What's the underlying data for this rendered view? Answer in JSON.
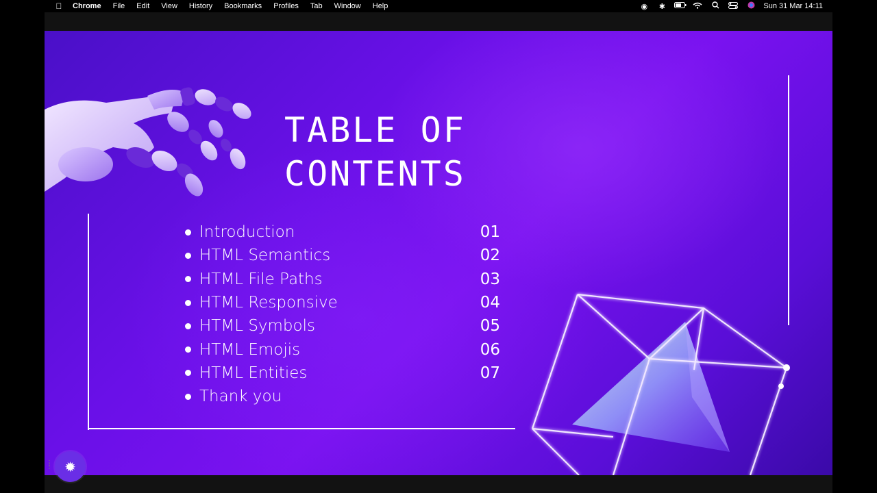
{
  "menubar": {
    "apple_icon": "apple-logo-icon",
    "app_name": "Chrome",
    "items": [
      "File",
      "Edit",
      "View",
      "History",
      "Bookmarks",
      "Profiles",
      "Tab",
      "Window",
      "Help"
    ],
    "tray_icons": [
      "screen-record-icon",
      "bluetooth-icon",
      "battery-icon",
      "wifi-icon",
      "spotlight-search-icon",
      "control-center-icon",
      "siri-icon"
    ],
    "clock": "Sun 31 Mar  14:11"
  },
  "slide": {
    "title_line1": "TABLE OF",
    "title_line2": "CONTENTS",
    "toc": [
      {
        "label": "Introduction",
        "number": "01"
      },
      {
        "label": "HTML Semantics",
        "number": "02"
      },
      {
        "label": "HTML File Paths",
        "number": "03"
      },
      {
        "label": "HTML Responsive",
        "number": "04"
      },
      {
        "label": "HTML Symbols",
        "number": "05"
      },
      {
        "label": "HTML Emojis",
        "number": "06"
      },
      {
        "label": "HTML Entities",
        "number": "07"
      },
      {
        "label": "Thank you",
        "number": ""
      }
    ],
    "colors": {
      "background_primary": "#6a10e8",
      "background_dark": "#3a0aa8",
      "text": "#ffffff"
    }
  },
  "overlay": {
    "helper_icon": "sparkle-icon",
    "drag_icon": "drag-handle-icon"
  }
}
